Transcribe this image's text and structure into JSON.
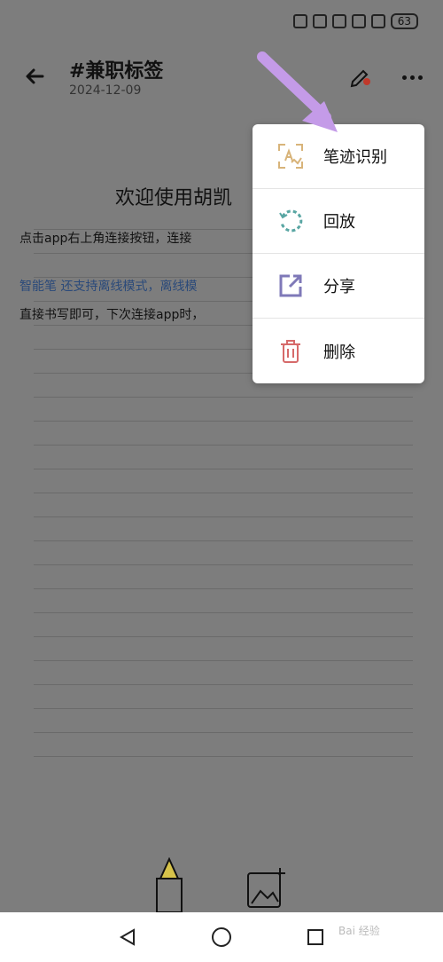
{
  "status": {
    "battery": "63"
  },
  "header": {
    "title": "#兼职标签",
    "date": "2024-12-09"
  },
  "note": {
    "headline": "欢迎使用胡凯",
    "line1": "点击app右上角连接按钮，连接",
    "line2": "智能笔 还支持离线模式，离线模",
    "line3": "直接书写即可，下次连接app时，"
  },
  "menu": {
    "items": [
      {
        "label": "笔迹识别",
        "icon": "handwriting-recognition-icon"
      },
      {
        "label": "回放",
        "icon": "replay-icon"
      },
      {
        "label": "分享",
        "icon": "share-icon"
      },
      {
        "label": "删除",
        "icon": "delete-icon"
      }
    ]
  },
  "watermark": "Bai 经验",
  "colors": {
    "accent_orange": "#d8b47a",
    "accent_teal": "#59a6a3",
    "accent_purple": "#7f79b8",
    "accent_red": "#d66a6a",
    "arrow": "#c49be8"
  }
}
